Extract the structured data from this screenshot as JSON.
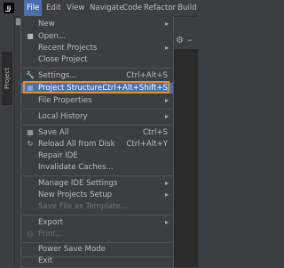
{
  "menubar": {
    "items": [
      "File",
      "Edit",
      "View",
      "Navigate",
      "Code",
      "Refactor",
      "Build"
    ],
    "active": "File"
  },
  "side_tab": "Project",
  "file_menu": {
    "items": [
      {
        "label": "New",
        "arrow": true
      },
      {
        "label": "Open..."
      },
      {
        "label": "Recent Projects",
        "arrow": true
      },
      {
        "label": "Close Project"
      },
      {
        "label": "Settings...",
        "shortcut": "Ctrl+Alt+S"
      },
      {
        "label": "Project Structure...",
        "shortcut": "Ctrl+Alt+Shift+S"
      },
      {
        "label": "File Properties",
        "arrow": true
      },
      {
        "label": "Local History",
        "arrow": true
      },
      {
        "label": "Save All",
        "shortcut": "Ctrl+S"
      },
      {
        "label": "Reload All from Disk",
        "shortcut": "Ctrl+Alt+Y"
      },
      {
        "label": "Repair IDE"
      },
      {
        "label": "Invalidate Caches..."
      },
      {
        "label": "Manage IDE Settings",
        "arrow": true
      },
      {
        "label": "New Projects Setup",
        "arrow": true
      },
      {
        "label": "Save File as Template...",
        "disabled": true
      },
      {
        "label": "Export",
        "arrow": true
      },
      {
        "label": "Print...",
        "disabled": true
      },
      {
        "label": "Power Save Mode"
      },
      {
        "label": "Exit"
      }
    ]
  },
  "colors": {
    "highlight": "#4b6eaf",
    "outline": "#f08a24",
    "background": "#3c3f41"
  }
}
